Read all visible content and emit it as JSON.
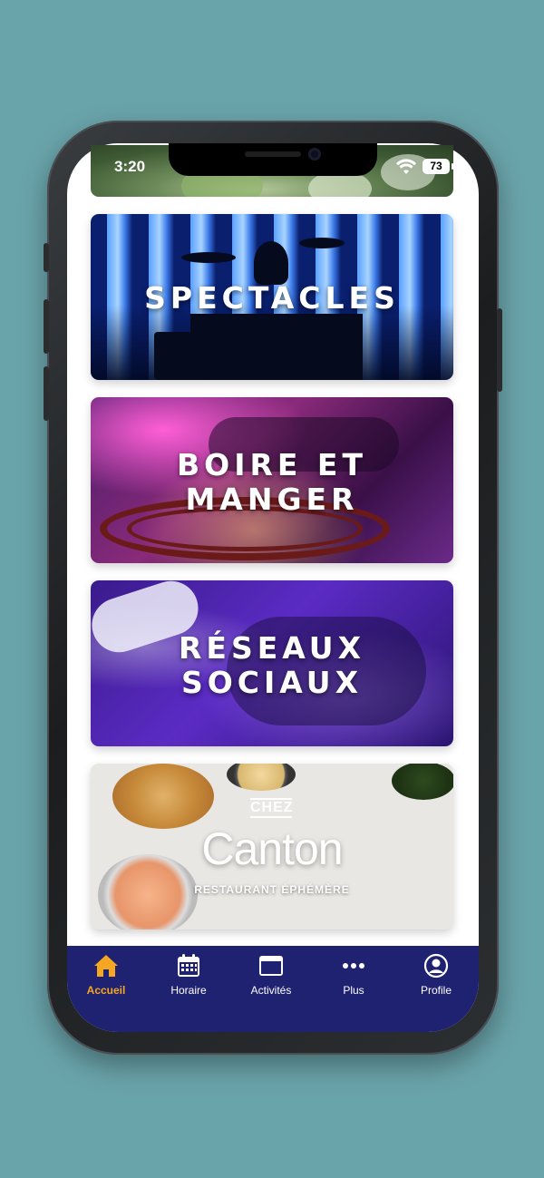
{
  "status_bar": {
    "time": "3:20",
    "battery": "73"
  },
  "cards": [
    {
      "title_line1": "SPECTACLES",
      "title_line2": ""
    },
    {
      "title_line1": "BOIRE ET",
      "title_line2": "MANGER"
    },
    {
      "title_line1": "RÉSEAUX",
      "title_line2": "SOCIAUX"
    }
  ],
  "restaurant_card": {
    "prefix": "CHEZ",
    "name": "Canton",
    "subtitle": "RESTAURANT ÉPHÉMÈRE"
  },
  "tabbar": {
    "items": [
      {
        "label": "Accueil",
        "icon": "home-icon",
        "active": true
      },
      {
        "label": "Horaire",
        "icon": "calendar-icon",
        "active": false
      },
      {
        "label": "Activités",
        "icon": "window-icon",
        "active": false
      },
      {
        "label": "Plus",
        "icon": "more-icon",
        "active": false
      },
      {
        "label": "Profile",
        "icon": "profile-icon",
        "active": false
      }
    ],
    "active_color": "#f5a623",
    "background": "#1e2270"
  }
}
